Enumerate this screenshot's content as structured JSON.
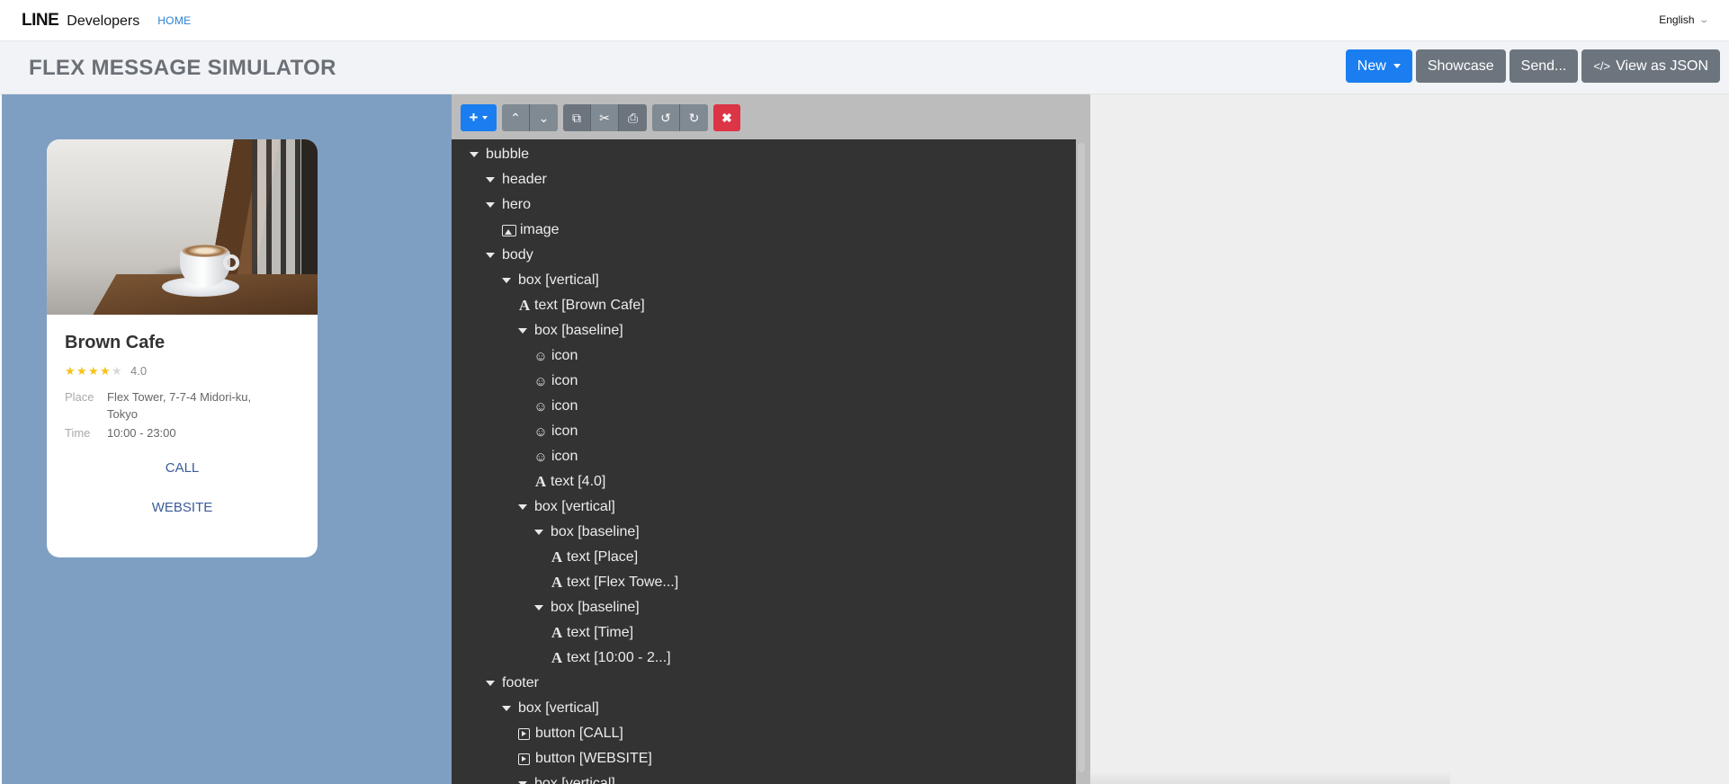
{
  "nav": {
    "brand_line": "LINE",
    "brand_developers": "Developers",
    "home": "HOME",
    "language": "English"
  },
  "header": {
    "title": "FLEX MESSAGE SIMULATOR",
    "actions": {
      "new": "New",
      "showcase": "Showcase",
      "send": "Send...",
      "view_json": "View as JSON"
    }
  },
  "preview": {
    "background_color": "#7f9fc2",
    "card": {
      "title": "Brown Cafe",
      "rating": "4.0",
      "stars_filled": 4,
      "stars_total": 5,
      "place_label": "Place",
      "place_value": "Flex Tower, 7-7-4 Midori-ku, Tokyo",
      "time_label": "Time",
      "time_value": "10:00 - 23:00",
      "call_button": "CALL",
      "website_button": "WEBSITE"
    }
  },
  "tree": {
    "toolbar_icons": [
      "add-icon",
      "move-up-icon",
      "move-down-icon",
      "copy-icon",
      "cut-icon",
      "paste-icon",
      "undo-icon",
      "redo-icon",
      "delete-icon"
    ],
    "nodes": [
      {
        "label": "bubble",
        "icon": "caret"
      },
      {
        "label": "header",
        "icon": "caret"
      },
      {
        "label": "hero",
        "icon": "caret"
      },
      {
        "label": "image",
        "icon": "image"
      },
      {
        "label": "body",
        "icon": "caret"
      },
      {
        "label": "box [vertical]",
        "icon": "caret"
      },
      {
        "label": "text [Brown Cafe]",
        "icon": "text"
      },
      {
        "label": "box [baseline]",
        "icon": "caret"
      },
      {
        "label": "icon",
        "icon": "smile"
      },
      {
        "label": "icon",
        "icon": "smile"
      },
      {
        "label": "icon",
        "icon": "smile"
      },
      {
        "label": "icon",
        "icon": "smile"
      },
      {
        "label": "icon",
        "icon": "smile"
      },
      {
        "label": "text [4.0]",
        "icon": "text"
      },
      {
        "label": "box [vertical]",
        "icon": "caret"
      },
      {
        "label": "box [baseline]",
        "icon": "caret"
      },
      {
        "label": "text [Place]",
        "icon": "text"
      },
      {
        "label": "text [Flex Towe...]",
        "icon": "text"
      },
      {
        "label": "box [baseline]",
        "icon": "caret"
      },
      {
        "label": "text [Time]",
        "icon": "text"
      },
      {
        "label": "text [10:00 - 2...]",
        "icon": "text"
      },
      {
        "label": "footer",
        "icon": "caret"
      },
      {
        "label": "box [vertical]",
        "icon": "caret"
      },
      {
        "label": "button [CALL]",
        "icon": "button"
      },
      {
        "label": "button [WEBSITE]",
        "icon": "button"
      },
      {
        "label": "box [vertical]",
        "icon": "caret"
      }
    ]
  },
  "colors": {
    "primary": "#1a7ef0",
    "secondary": "#6c757d",
    "danger": "#dc3545",
    "tree_bg": "#333333"
  }
}
